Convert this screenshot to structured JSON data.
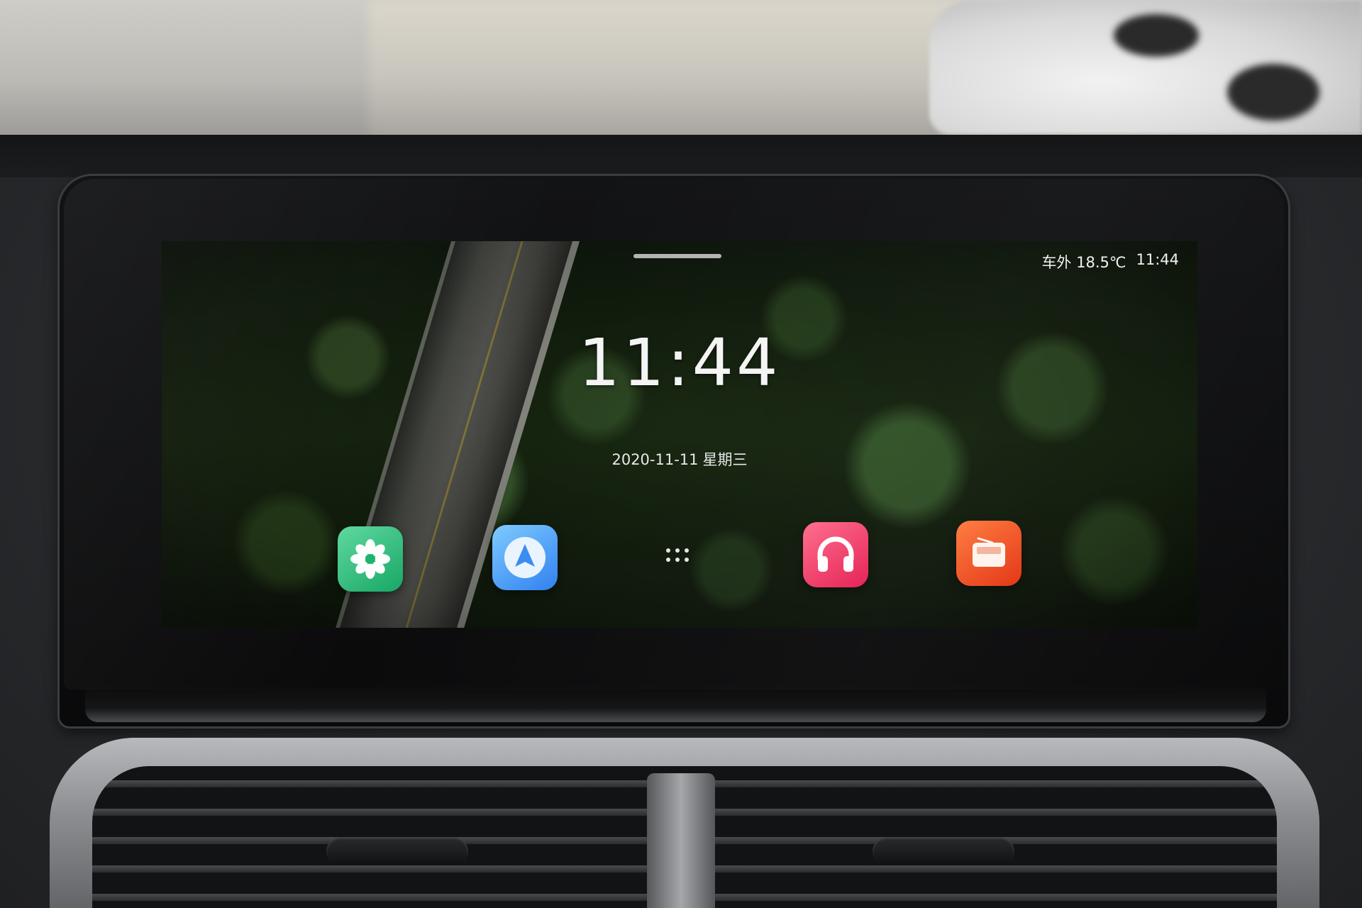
{
  "status_bar": {
    "temperature": "车外 18.5℃",
    "time": "11:44"
  },
  "lock_screen": {
    "clock": "11:44",
    "date": "2020-11-11",
    "weekday": "星期三"
  },
  "dock": {
    "apps": [
      {
        "icon": "settings-pinwheel-icon",
        "color": "#1fb36e"
      },
      {
        "icon": "navigation-arrow-icon",
        "color": "#3a8bf2"
      },
      {
        "icon": "app-grid-icon",
        "color": "#e6e6e6"
      },
      {
        "icon": "headphones-icon",
        "color": "#e8245a"
      },
      {
        "icon": "radio-icon",
        "color": "#ea3d16"
      }
    ]
  }
}
